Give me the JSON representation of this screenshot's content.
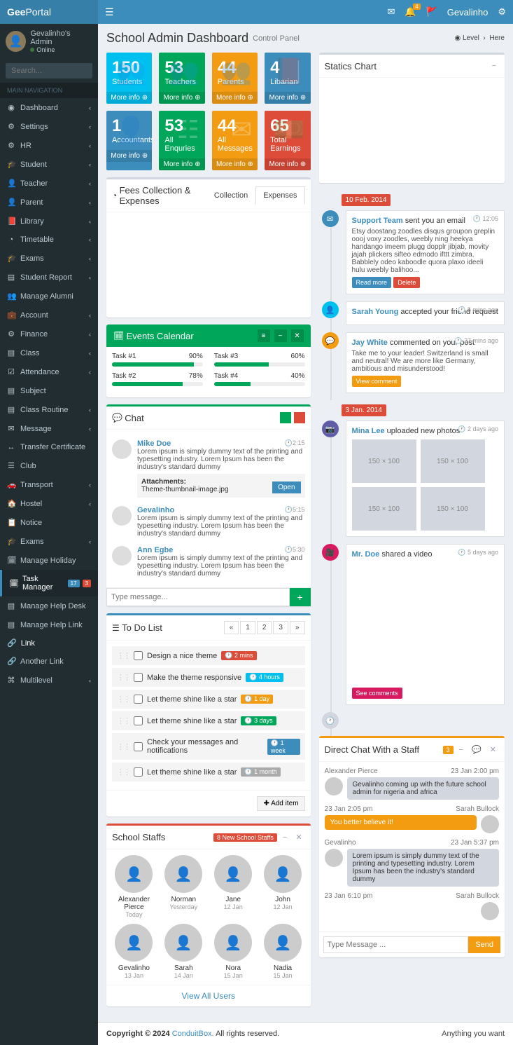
{
  "brand": {
    "bold": "Gee",
    "rest": "Portal"
  },
  "user": {
    "name": "Gevalinho's Admin",
    "status": "Online"
  },
  "search": {
    "placeholder": "Search..."
  },
  "nav_header": "MAIN NAVIGATION",
  "sidebar": [
    {
      "label": "Dashboard",
      "icon": "◉",
      "chev": true
    },
    {
      "label": "Settings",
      "icon": "⚙",
      "chev": true
    },
    {
      "label": "HR",
      "icon": "⚙",
      "chev": true
    },
    {
      "label": "Student",
      "icon": "🎓",
      "chev": true
    },
    {
      "label": "Teacher",
      "icon": "👤",
      "chev": true
    },
    {
      "label": "Parent",
      "icon": "👤",
      "chev": true
    },
    {
      "label": "Library",
      "icon": "📕",
      "chev": true
    },
    {
      "label": "Timetable",
      "icon": "◔",
      "chev": true
    },
    {
      "label": "Exams",
      "icon": "🎓",
      "chev": true
    },
    {
      "label": "Student Report",
      "icon": "▤",
      "chev": true
    },
    {
      "label": "Manage Alumni",
      "icon": "👥"
    },
    {
      "label": "Account",
      "icon": "💼",
      "chev": true
    },
    {
      "label": "Finance",
      "icon": "⚙",
      "chev": true
    },
    {
      "label": "Class",
      "icon": "▤",
      "chev": true
    },
    {
      "label": "Attendance",
      "icon": "☑",
      "chev": true
    },
    {
      "label": "Subject",
      "icon": "▤"
    },
    {
      "label": "Class Routine",
      "icon": "▤",
      "chev": true
    },
    {
      "label": "Message",
      "icon": "✉",
      "chev": true
    },
    {
      "label": "Transfer Certificate",
      "icon": "↔"
    },
    {
      "label": "Club",
      "icon": "☰"
    },
    {
      "label": "Transport",
      "icon": "🚗",
      "chev": true
    },
    {
      "label": "Hostel",
      "icon": "🏠",
      "chev": true
    },
    {
      "label": "Notice",
      "icon": "📋"
    },
    {
      "label": "Exams",
      "icon": "🎓",
      "chev": true
    },
    {
      "label": "Manage Holiday",
      "icon": "🗓"
    },
    {
      "label": "Task Manager",
      "icon": "🗓",
      "badges": [
        {
          "txt": "17",
          "cls": "bg-blue"
        },
        {
          "txt": "3",
          "cls": "bg-red"
        }
      ],
      "active": true
    },
    {
      "label": "Manage Help Desk",
      "icon": "▤"
    },
    {
      "label": "Manage Help Link",
      "icon": "▤"
    }
  ],
  "sidebar_label_header": "Link",
  "sidebar_labels": [
    {
      "label": "Another Link",
      "icon": "🔗"
    },
    {
      "label": "Multilevel",
      "icon": "⌘",
      "chev": true
    }
  ],
  "topbar": {
    "badges": {
      "mail": "4"
    },
    "user": "Gevalinho"
  },
  "header": {
    "title": "School Admin Dashboard",
    "subtitle": "Control Panel",
    "bc1": "Level",
    "bc2": "Here"
  },
  "stats": [
    [
      {
        "num": "150",
        "label": "Students",
        "cls": "bg-aqua",
        "icon": "👥"
      },
      {
        "num": "53",
        "label": "Teachers",
        "cls": "bg-green",
        "icon": "👥"
      },
      {
        "num": "44",
        "label": "Parents",
        "cls": "bg-yellow",
        "icon": "👥"
      },
      {
        "num": "4",
        "label": "Libarian",
        "cls": "bg-blue",
        "icon": "📕"
      }
    ],
    [
      {
        "num": "1",
        "label": "Accountants",
        "cls": "bg-blue",
        "icon": "👤"
      },
      {
        "num": "53",
        "label": "All Enquries",
        "cls": "bg-green",
        "icon": "☷"
      },
      {
        "num": "44",
        "label": "All Messages",
        "cls": "bg-yellow",
        "icon": "✉"
      },
      {
        "num": "65",
        "label": "Total Earnings",
        "cls": "bg-red",
        "icon": "💵"
      }
    ]
  ],
  "more_info": "More info",
  "fees": {
    "title": "Fees Collection & Expenses",
    "tab1": "Collection",
    "tab2": "Expenses"
  },
  "statics": {
    "title": "Statics Chart"
  },
  "events": {
    "title": "Events Calendar",
    "tasks": [
      {
        "name": "Task #1",
        "pct": 90
      },
      {
        "name": "Task #3",
        "pct": 60
      },
      {
        "name": "Task #2",
        "pct": 78
      },
      {
        "name": "Task #4",
        "pct": 40
      }
    ]
  },
  "chat": {
    "title": "Chat",
    "input_ph": "Type message...",
    "msgs": [
      {
        "name": "Mike Doe",
        "time": "2:15",
        "txt": "Lorem ipsum is simply dummy text of the printing and typesetting industry. Lorem Ipsum has been the industry's standard dummy",
        "attach": {
          "title": "Attachments:",
          "file": "Theme-thumbnail-image.jpg",
          "btn": "Open"
        }
      },
      {
        "name": "Gevalinho",
        "time": "5:15",
        "txt": "Lorem ipsum is simply dummy text of the printing and typesetting industry. Lorem Ipsum has been the industry's standard dummy"
      },
      {
        "name": "Ann Egbe",
        "time": "5:30",
        "txt": "Lorem ipsum is simply dummy text of the printing and typesetting industry. Lorem Ipsum has been the industry's standard dummy"
      }
    ]
  },
  "todo": {
    "title": "To Do List",
    "pages": [
      "«",
      "1",
      "2",
      "3",
      "»"
    ],
    "add": "Add item",
    "items": [
      {
        "txt": "Design a nice theme",
        "tag": "2 mins",
        "cls": "bg-red"
      },
      {
        "txt": "Make the theme responsive",
        "tag": "4 hours",
        "cls": "bg-aqua"
      },
      {
        "txt": "Let theme shine like a star",
        "tag": "1 day",
        "cls": "bg-yellow"
      },
      {
        "txt": "Let theme shine like a star",
        "tag": "3 days",
        "cls": "bg-green"
      },
      {
        "txt": "Check your messages and notifications",
        "tag": "1 week",
        "cls": "bg-blue"
      },
      {
        "txt": "Let theme shine like a star",
        "tag": "1 month",
        "cls": "bg-default",
        "tagcolor": "#aaa"
      }
    ]
  },
  "staffs": {
    "title": "School Staffs",
    "badge": "8 New School Staffs",
    "view_all": "View All Users",
    "list": [
      {
        "name": "Alexander Pierce",
        "date": "Today"
      },
      {
        "name": "Norman",
        "date": "Yesterday"
      },
      {
        "name": "Jane",
        "date": "12 Jan"
      },
      {
        "name": "John",
        "date": "12 Jan"
      },
      {
        "name": "Gevalinho",
        "date": "13 Jan"
      },
      {
        "name": "Sarah",
        "date": "14 Jan"
      },
      {
        "name": "Nora",
        "date": "15 Jan"
      },
      {
        "name": "Nadia",
        "date": "15 Jan"
      }
    ]
  },
  "timeline": {
    "date1": "10 Feb. 2014",
    "date2": "3 Jan. 2014",
    "items": [
      {
        "icon": "✉",
        "cls": "bg-blue",
        "time": "12:05",
        "head_a": "Support Team",
        "head_t": " sent you an email",
        "txt": "Etsy doostang zoodles disqus groupon greplin oooj voxy zoodles, weebly ning heekya handango imeem plugg dopplr jibjab, movity jajah plickers sifteo edmodo ifttt zimbra. Babblely odeo kaboodle quora plaxo ideeli hulu weebly balihoo...",
        "btns": [
          {
            "txt": "Read more",
            "cls": "bg-blue"
          },
          {
            "txt": "Delete",
            "cls": "bg-red"
          }
        ]
      },
      {
        "icon": "👤",
        "cls": "bg-aqua",
        "time": "5 mins ago",
        "head_a": "Sarah Young",
        "head_t": " accepted your friend request"
      },
      {
        "icon": "💬",
        "cls": "bg-yellow",
        "time": "27 mins ago",
        "head_a": "Jay White",
        "head_t": " commented on your post",
        "txt": "Take me to your leader! Switzerland is small and neutral! We are more like Germany, ambitious and misunderstood!",
        "btns": [
          {
            "txt": "View comment",
            "cls": "bg-yellow"
          }
        ]
      }
    ],
    "items2": [
      {
        "icon": "📷",
        "cls": "bg-purple",
        "time": "2 days ago",
        "head_a": "Mina Lee",
        "head_t": " uploaded new photos",
        "photos": [
          "150 × 100",
          "150 × 100",
          "150 × 100",
          "150 × 100"
        ]
      },
      {
        "icon": "🎥",
        "cls": "bg-maroon",
        "time": "5 days ago",
        "head_a": "Mr. Doe",
        "head_t": " shared a video",
        "btns_bottom": [
          {
            "txt": "See comments",
            "cls": "bg-maroon"
          }
        ]
      }
    ]
  },
  "direct": {
    "title": "Direct Chat With a Staff",
    "badge": "3",
    "input_ph": "Type Message ...",
    "send": "Send",
    "msgs": [
      {
        "name": "Alexander Pierce",
        "time": "23 Jan 2:00 pm",
        "txt": "Gevalinho coming up with the future school admin for nigeria and africa",
        "right": false
      },
      {
        "name": "Sarah Bullock",
        "time": "23 Jan 2:05 pm",
        "txt": "You better believe it!",
        "right": true
      },
      {
        "name": "Gevalinho",
        "time": "23 Jan 5:37 pm",
        "txt": "Lorem ipsum is simply dummy text of the printing and typesetting industry. Lorem Ipsum has been the industry's standard dummy",
        "right": false
      },
      {
        "name": "Sarah Bullock",
        "time": "23 Jan 6:10 pm",
        "txt": "",
        "right": true,
        "empty": true
      }
    ]
  },
  "footer": {
    "copy": "Copyright © 2024 ",
    "brand": "ConduitBox.",
    "rights": " All rights reserved.",
    "right": "Anything you want"
  }
}
